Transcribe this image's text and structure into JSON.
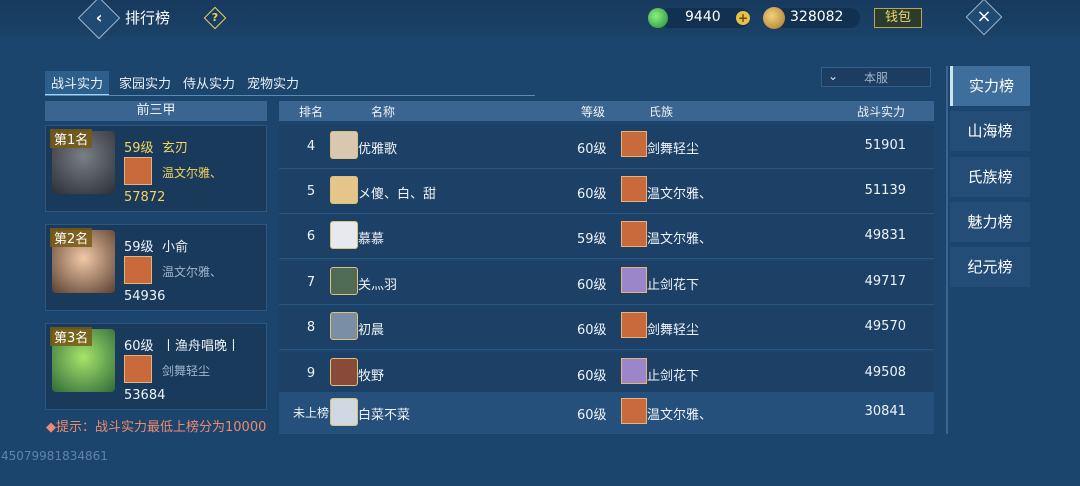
{
  "header": {
    "title": "排行榜",
    "jade": "9440",
    "gold": "328082",
    "wallet_label": "钱包",
    "back_icon": "chevron-left-icon",
    "help_icon": "question-icon",
    "close_icon": "close-icon"
  },
  "tabs": [
    {
      "label": "战斗实力",
      "active": true
    },
    {
      "label": "家园实力"
    },
    {
      "label": "侍从实力"
    },
    {
      "label": "宠物实力"
    }
  ],
  "server_select": {
    "value": "本服"
  },
  "top3": {
    "header": "前三甲",
    "cards": [
      {
        "rank": "第1名",
        "level": "59级",
        "name": "玄刃",
        "clan": "温文尔雅、",
        "power": "57872"
      },
      {
        "rank": "第2名",
        "level": "59级",
        "name": "小俞",
        "clan": "温文尔雅、",
        "power": "54936"
      },
      {
        "rank": "第3名",
        "level": "60级",
        "name": "丨渔舟唱晚丨",
        "clan": "剑舞轻尘",
        "power": "53684"
      }
    ]
  },
  "table": {
    "headers": {
      "rank": "排名",
      "name": "名称",
      "level": "等级",
      "clan": "氏族",
      "power": "战斗实力"
    },
    "rows": [
      {
        "rank": "4",
        "name": "优雅歌",
        "level": "60级",
        "clan": "剑舞轻尘",
        "power": "51901"
      },
      {
        "rank": "5",
        "name": "メ傻、白、甜",
        "level": "60级",
        "clan": "温文尔雅、",
        "power": "51139"
      },
      {
        "rank": "6",
        "name": "慕慕",
        "level": "59级",
        "clan": "温文尔雅、",
        "power": "49831"
      },
      {
        "rank": "7",
        "name": "关灬羽",
        "level": "60级",
        "clan": "止剑花下",
        "power": "49717"
      },
      {
        "rank": "8",
        "name": "初晨",
        "level": "60级",
        "clan": "剑舞轻尘",
        "power": "49570"
      },
      {
        "rank": "9",
        "name": "牧野",
        "level": "60级",
        "clan": "止剑花下",
        "power": "49508"
      }
    ],
    "self": {
      "rank": "未上榜",
      "name": "白菜不菜",
      "level": "60级",
      "clan": "温文尔雅、",
      "power": "30841"
    }
  },
  "hint": "提示：战斗实力最低上榜分为10000",
  "uid": "45079981834861",
  "side_tabs": [
    {
      "label": "实力榜",
      "active": true
    },
    {
      "label": "山海榜"
    },
    {
      "label": "氏族榜"
    },
    {
      "label": "魅力榜"
    },
    {
      "label": "纪元榜"
    }
  ],
  "colors": {
    "background": "#1c456e",
    "gold": "#f2d45e",
    "hint": "#f08a6e",
    "clan_orange": "#c86a3c",
    "clan_purple": "#9b86c9"
  }
}
